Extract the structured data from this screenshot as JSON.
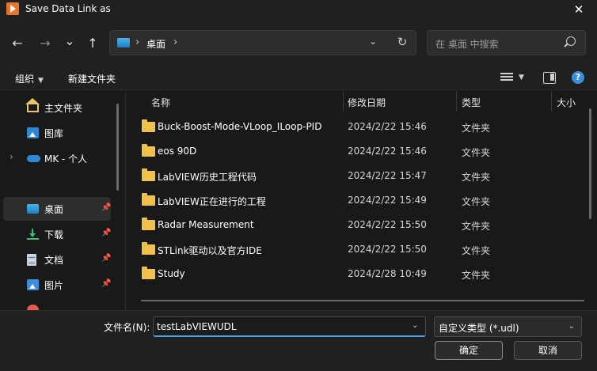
{
  "window": {
    "title": "Save Data Link as",
    "close_glyph": "✕"
  },
  "nav": {
    "back_glyph": "←",
    "forward_glyph": "→",
    "recent_glyph": "⌄",
    "up_glyph": "↑",
    "breadcrumb_sep": "›",
    "location": "桌面",
    "refresh_glyph": "↻",
    "dropdown_glyph": "⌄",
    "search_placeholder": "在 桌面 中搜索"
  },
  "toolbar": {
    "organize": "组织",
    "new_folder": "新建文件夹",
    "caret": "▼",
    "help": "?"
  },
  "sidebar": {
    "items": [
      {
        "label": "主文件夹",
        "icon": "home-icon"
      },
      {
        "label": "图库",
        "icon": "gallery-icon"
      },
      {
        "label": "MK - 个人",
        "icon": "onedrive-cloud-icon",
        "expand": "›"
      },
      {
        "label": "桌面",
        "icon": "desktop-icon",
        "pinned": true,
        "selected": true
      },
      {
        "label": "下载",
        "icon": "download-icon",
        "pinned": true
      },
      {
        "label": "文档",
        "icon": "documents-icon",
        "pinned": true
      },
      {
        "label": "图片",
        "icon": "pictures-icon",
        "pinned": true
      }
    ],
    "pin_glyph": "📌"
  },
  "columns": {
    "name": "名称",
    "modified": "修改日期",
    "type": "类型",
    "size": "大小",
    "sort_glyph": "˄"
  },
  "files": [
    {
      "name": "Buck-Boost-Mode-VLoop_ILoop-PID",
      "modified": "2024/2/22 15:46",
      "type": "文件夹"
    },
    {
      "name": "eos 90D",
      "modified": "2024/2/22 15:46",
      "type": "文件夹"
    },
    {
      "name": "LabVIEW历史工程代码",
      "modified": "2024/2/22 15:47",
      "type": "文件夹"
    },
    {
      "name": "LabVIEW正在进行的工程",
      "modified": "2024/2/22 15:49",
      "type": "文件夹"
    },
    {
      "name": "Radar Measurement",
      "modified": "2024/2/22 15:50",
      "type": "文件夹"
    },
    {
      "name": "STLink驱动以及官方IDE",
      "modified": "2024/2/22 15:50",
      "type": "文件夹"
    },
    {
      "name": "Study",
      "modified": "2024/2/28 10:49",
      "type": "文件夹"
    }
  ],
  "save": {
    "filename_label": "文件名(N):",
    "filename_value": "testLabVIEWUDL",
    "filetype_value": "自定义类型 (*.udl)",
    "caret": "⌄",
    "ok": "确定",
    "cancel": "取消"
  }
}
